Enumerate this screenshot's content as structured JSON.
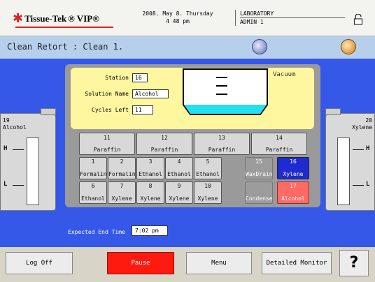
{
  "header": {
    "brand": "Tissue-Tek",
    "brand_suffix": "® VIP®",
    "date_line1": "2008. May 8. Thursday",
    "date_line2": "4 48 pm",
    "location_line1": "LABORATORY",
    "location_line2": "ADMIN 1"
  },
  "title": "Clean Retort : Clean 1.",
  "info": {
    "station_label": "Station",
    "station_value": "16",
    "solution_label": "Solution Name",
    "solution_value": "Alcohol",
    "cycles_label": "Cycles Left",
    "cycles_value": "11",
    "vacuum": "Vacuum"
  },
  "paraffin_stations": [
    {
      "num": "11",
      "name": "Paraffin"
    },
    {
      "num": "12",
      "name": "Paraffin"
    },
    {
      "num": "13",
      "name": "Paraffin"
    },
    {
      "num": "14",
      "name": "Paraffin"
    }
  ],
  "row2": [
    {
      "num": "1",
      "name": "Formalin"
    },
    {
      "num": "2",
      "name": "Formalin"
    },
    {
      "num": "3",
      "name": "Ethanol"
    },
    {
      "num": "4",
      "name": "Ethanol"
    },
    {
      "num": "5",
      "name": "Ethanol"
    },
    {
      "num": "15",
      "name": "WaxDrain"
    },
    {
      "num": "16",
      "name": "Xylene"
    }
  ],
  "row3": [
    {
      "num": "6",
      "name": "Ethanol"
    },
    {
      "num": "7",
      "name": "Xylene"
    },
    {
      "num": "8",
      "name": "Xylene"
    },
    {
      "num": "9",
      "name": "Xylene"
    },
    {
      "num": "10",
      "name": "Xylene"
    },
    {
      "num": "",
      "name": "Condense"
    },
    {
      "num": "17",
      "name": "Alcohol"
    }
  ],
  "left_bottle": {
    "num": "19",
    "name": "Alcohol",
    "high": "H",
    "low": "L"
  },
  "right_bottle": {
    "num": "20",
    "name": "Xylene",
    "high": "H",
    "low": "L"
  },
  "expected_end_label": "Expected End Time",
  "expected_end_value": "7:02 pm",
  "buttons": {
    "logoff": "Log Off",
    "pause": "Pause",
    "menu": "Menu",
    "monitor": "Detailed Monitor",
    "help": "?"
  },
  "colors": {
    "accent_blue": "#3558e8",
    "pause_red": "#ff1a10",
    "selected_blue": "#1f2bd0",
    "active_red": "#ff6a66"
  }
}
